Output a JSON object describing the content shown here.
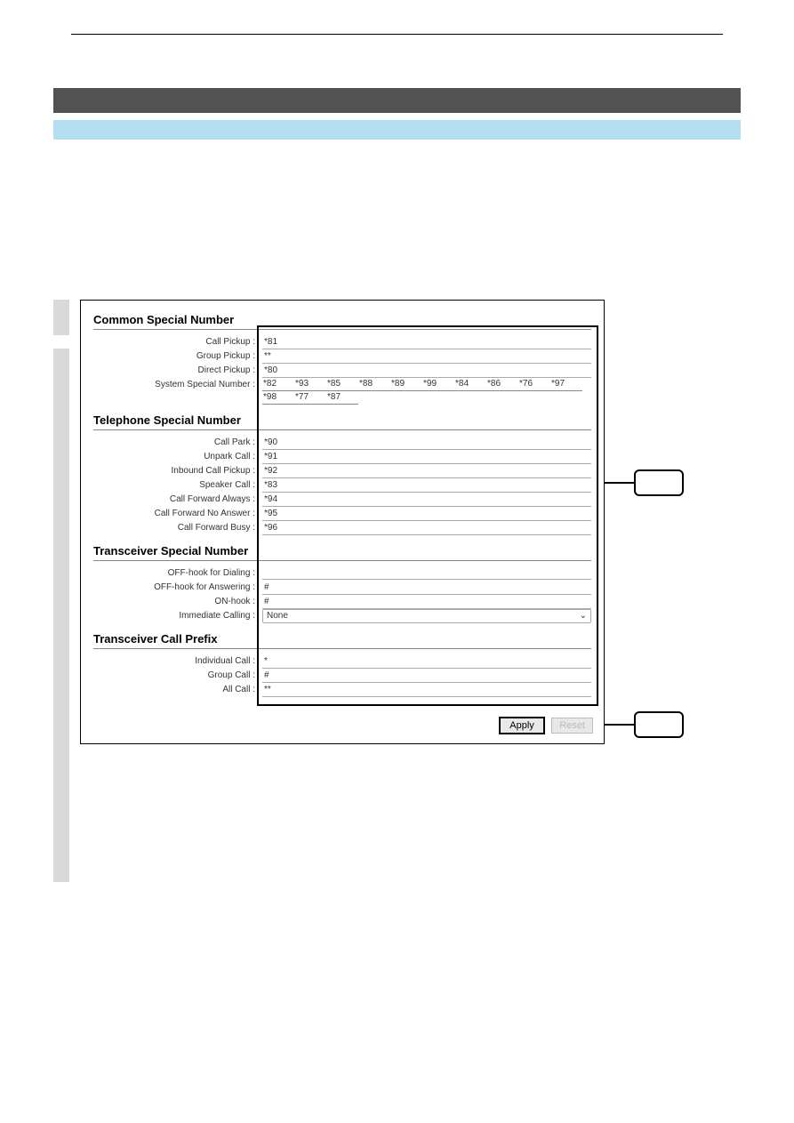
{
  "sections": {
    "common": {
      "title": "Common Special Number",
      "call_pickup": {
        "label": "Call Pickup :",
        "value": "*81"
      },
      "group_pickup": {
        "label": "Group Pickup :",
        "value": "**"
      },
      "direct_pickup": {
        "label": "Direct Pickup :",
        "value": "*80"
      },
      "system_special": {
        "label": "System Special Number :",
        "values": [
          "*82",
          "*93",
          "*85",
          "*88",
          "*89",
          "*99",
          "*84",
          "*86",
          "*76",
          "*97",
          "*98",
          "*77",
          "*87"
        ]
      }
    },
    "telephone": {
      "title": "Telephone Special Number",
      "call_park": {
        "label": "Call Park :",
        "value": "*90"
      },
      "unpark_call": {
        "label": "Unpark Call :",
        "value": "*91"
      },
      "inbound_call_pickup": {
        "label": "Inbound Call Pickup :",
        "value": "*92"
      },
      "speaker_call": {
        "label": "Speaker Call :",
        "value": "*83"
      },
      "cf_always": {
        "label": "Call Forward Always :",
        "value": "*94"
      },
      "cf_no_answer": {
        "label": "Call Forward No Answer :",
        "value": "*95"
      },
      "cf_busy": {
        "label": "Call Forward Busy :",
        "value": "*96"
      }
    },
    "transceiver": {
      "title": "Transceiver Special Number",
      "off_hook_dial": {
        "label": "OFF-hook for Dialing :",
        "value": ""
      },
      "off_hook_ans": {
        "label": "OFF-hook for Answering :",
        "value": "#"
      },
      "on_hook": {
        "label": "ON-hook :",
        "value": "#"
      },
      "immediate": {
        "label": "Immediate Calling :",
        "value": "None"
      }
    },
    "prefix": {
      "title": "Transceiver Call Prefix",
      "individual": {
        "label": "Individual Call :",
        "value": "*"
      },
      "group": {
        "label": "Group Call :",
        "value": "#"
      },
      "all": {
        "label": "All Call :",
        "value": "**"
      }
    }
  },
  "buttons": {
    "apply": "Apply",
    "reset": "Reset"
  }
}
